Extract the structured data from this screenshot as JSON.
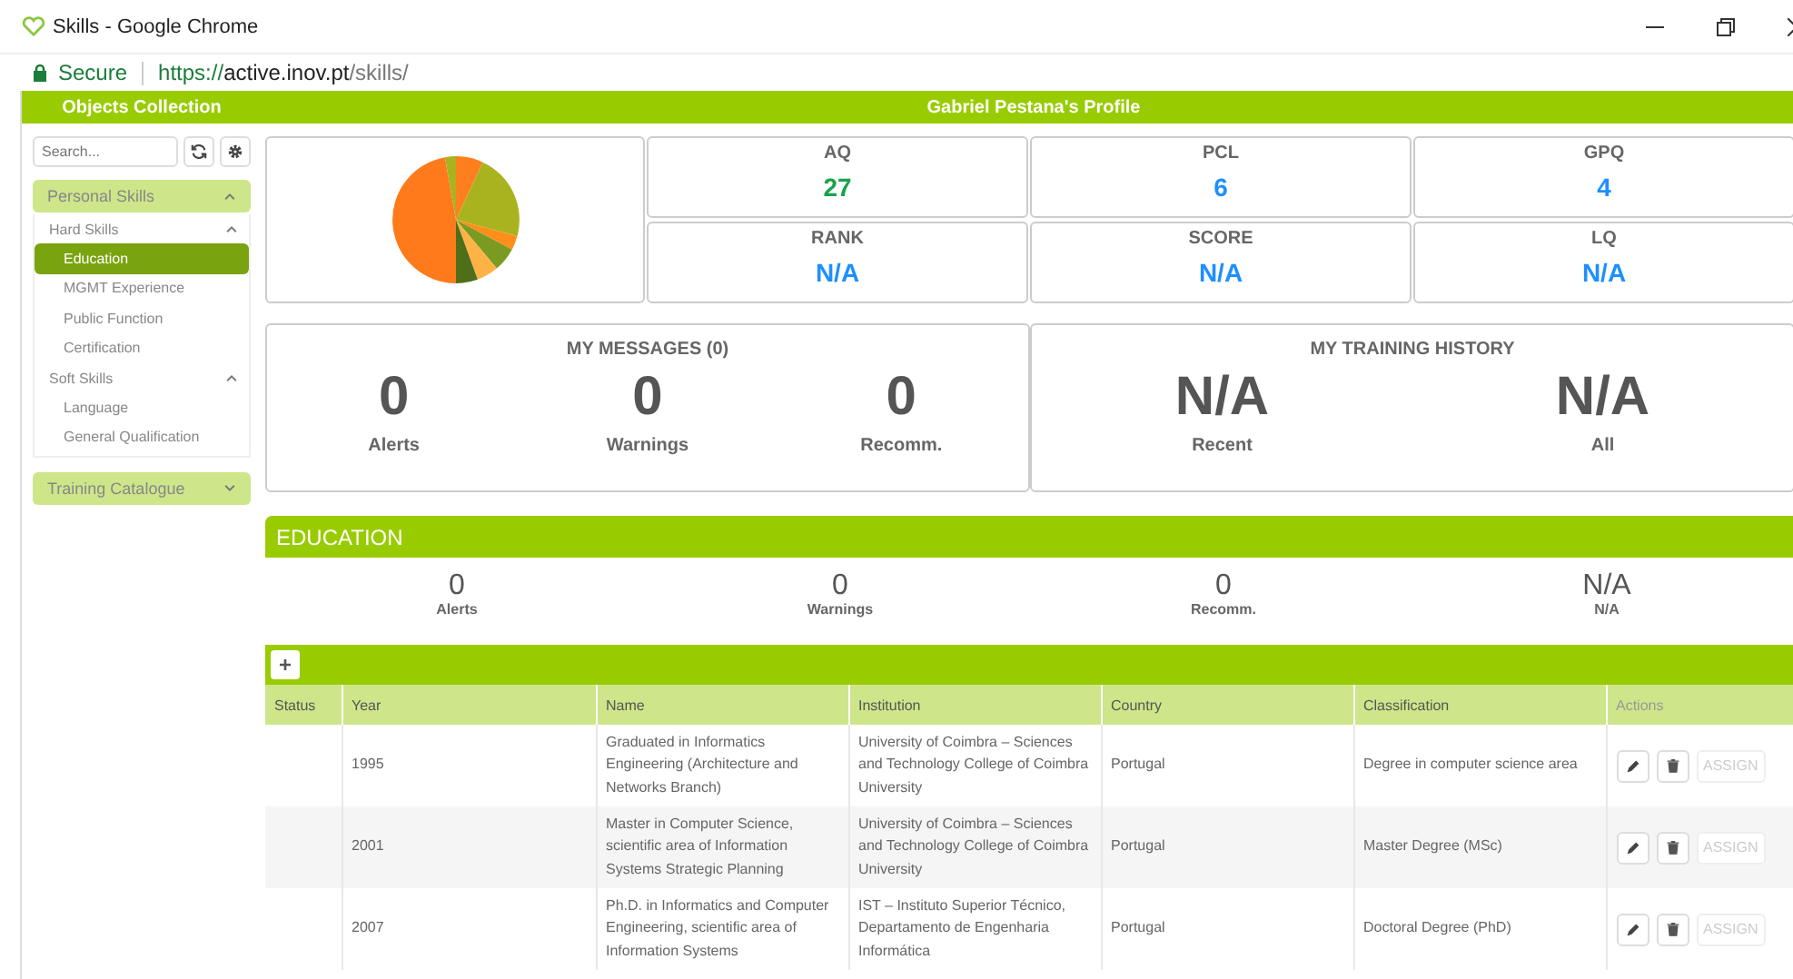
{
  "window": {
    "title": "Skills - Google Chrome"
  },
  "address_bar": {
    "secure_label": "Secure",
    "url_scheme": "https://",
    "url_host": "active.inov.pt",
    "url_path": "/skills/"
  },
  "sidebar": {
    "title": "Objects Collection",
    "search": {
      "placeholder": "Search..."
    },
    "sections": [
      {
        "label": "Personal Skills",
        "expanded": true,
        "children": [
          {
            "label": "Hard Skills",
            "expanded": true,
            "children": [
              {
                "label": "Education",
                "selected": true
              },
              {
                "label": "MGMT Experience",
                "selected": false
              },
              {
                "label": "Public Function",
                "selected": false
              },
              {
                "label": "Certification",
                "selected": false
              }
            ]
          },
          {
            "label": "Soft Skills",
            "expanded": true,
            "children": [
              {
                "label": "Language",
                "selected": false
              },
              {
                "label": "General Qualification",
                "selected": false
              }
            ]
          }
        ]
      },
      {
        "label": "Training Catalogue",
        "expanded": false
      }
    ]
  },
  "profile": {
    "title": "Gabriel Pestana's Profile",
    "metrics": [
      {
        "label": "AQ",
        "value": "27",
        "color": "#1aa34a"
      },
      {
        "label": "PCL",
        "value": "6",
        "color": "#1e8fff"
      },
      {
        "label": "GPQ",
        "value": "4",
        "color": "#1e8fff"
      },
      {
        "label": "RANK",
        "value": "N/A",
        "color": "#1e8fff"
      },
      {
        "label": "SCORE",
        "value": "N/A",
        "color": "#1e8fff"
      },
      {
        "label": "LQ",
        "value": "N/A",
        "color": "#1e8fff"
      }
    ]
  },
  "messages": {
    "title": "MY MESSAGES (0)",
    "stats": [
      {
        "value": "0",
        "label": "Alerts"
      },
      {
        "value": "0",
        "label": "Warnings"
      },
      {
        "value": "0",
        "label": "Recomm."
      }
    ]
  },
  "training_history": {
    "title": "MY TRAINING HISTORY",
    "stats": [
      {
        "value": "N/A",
        "label": "Recent"
      },
      {
        "value": "N/A",
        "label": "All"
      }
    ]
  },
  "education": {
    "title": "EDUCATION",
    "summary": [
      {
        "value": "0",
        "label": "Alerts"
      },
      {
        "value": "0",
        "label": "Warnings"
      },
      {
        "value": "0",
        "label": "Recomm."
      },
      {
        "value": "N/A",
        "label": "N/A"
      }
    ],
    "add_button": "+",
    "table": {
      "columns": [
        "Status",
        "Year",
        "Name",
        "Institution",
        "Country",
        "Classification",
        "Actions"
      ],
      "rows": [
        {
          "year": "1995",
          "name": "Graduated in Informatics Engineering (Architecture and Networks Branch)",
          "institution": "University of Coimbra – Sciences and Technology College of Coimbra University",
          "country": "Portugal",
          "classification": "Degree in computer science area",
          "assign": "ASSIGN",
          "assign_disabled": true
        },
        {
          "year": "2001",
          "name": "Master in Computer Science, scientific area of Information Systems Strategic Planning",
          "institution": "University of Coimbra – Sciences and Technology College of Coimbra University",
          "country": "Portugal",
          "classification": "Master Degree (MSc)",
          "assign": "ASSIGN",
          "assign_disabled": true
        },
        {
          "year": "2007",
          "name": "Ph.D. in Informatics and Computer Engineering, scientific area of Information Systems",
          "institution": "IST – Instituto Superior Técnico, Departamento de Engenharia Informática",
          "country": "Portugal",
          "classification": "Doctoral Degree (PhD)",
          "assign": "ASSIGN",
          "assign_disabled": true
        }
      ]
    }
  }
}
